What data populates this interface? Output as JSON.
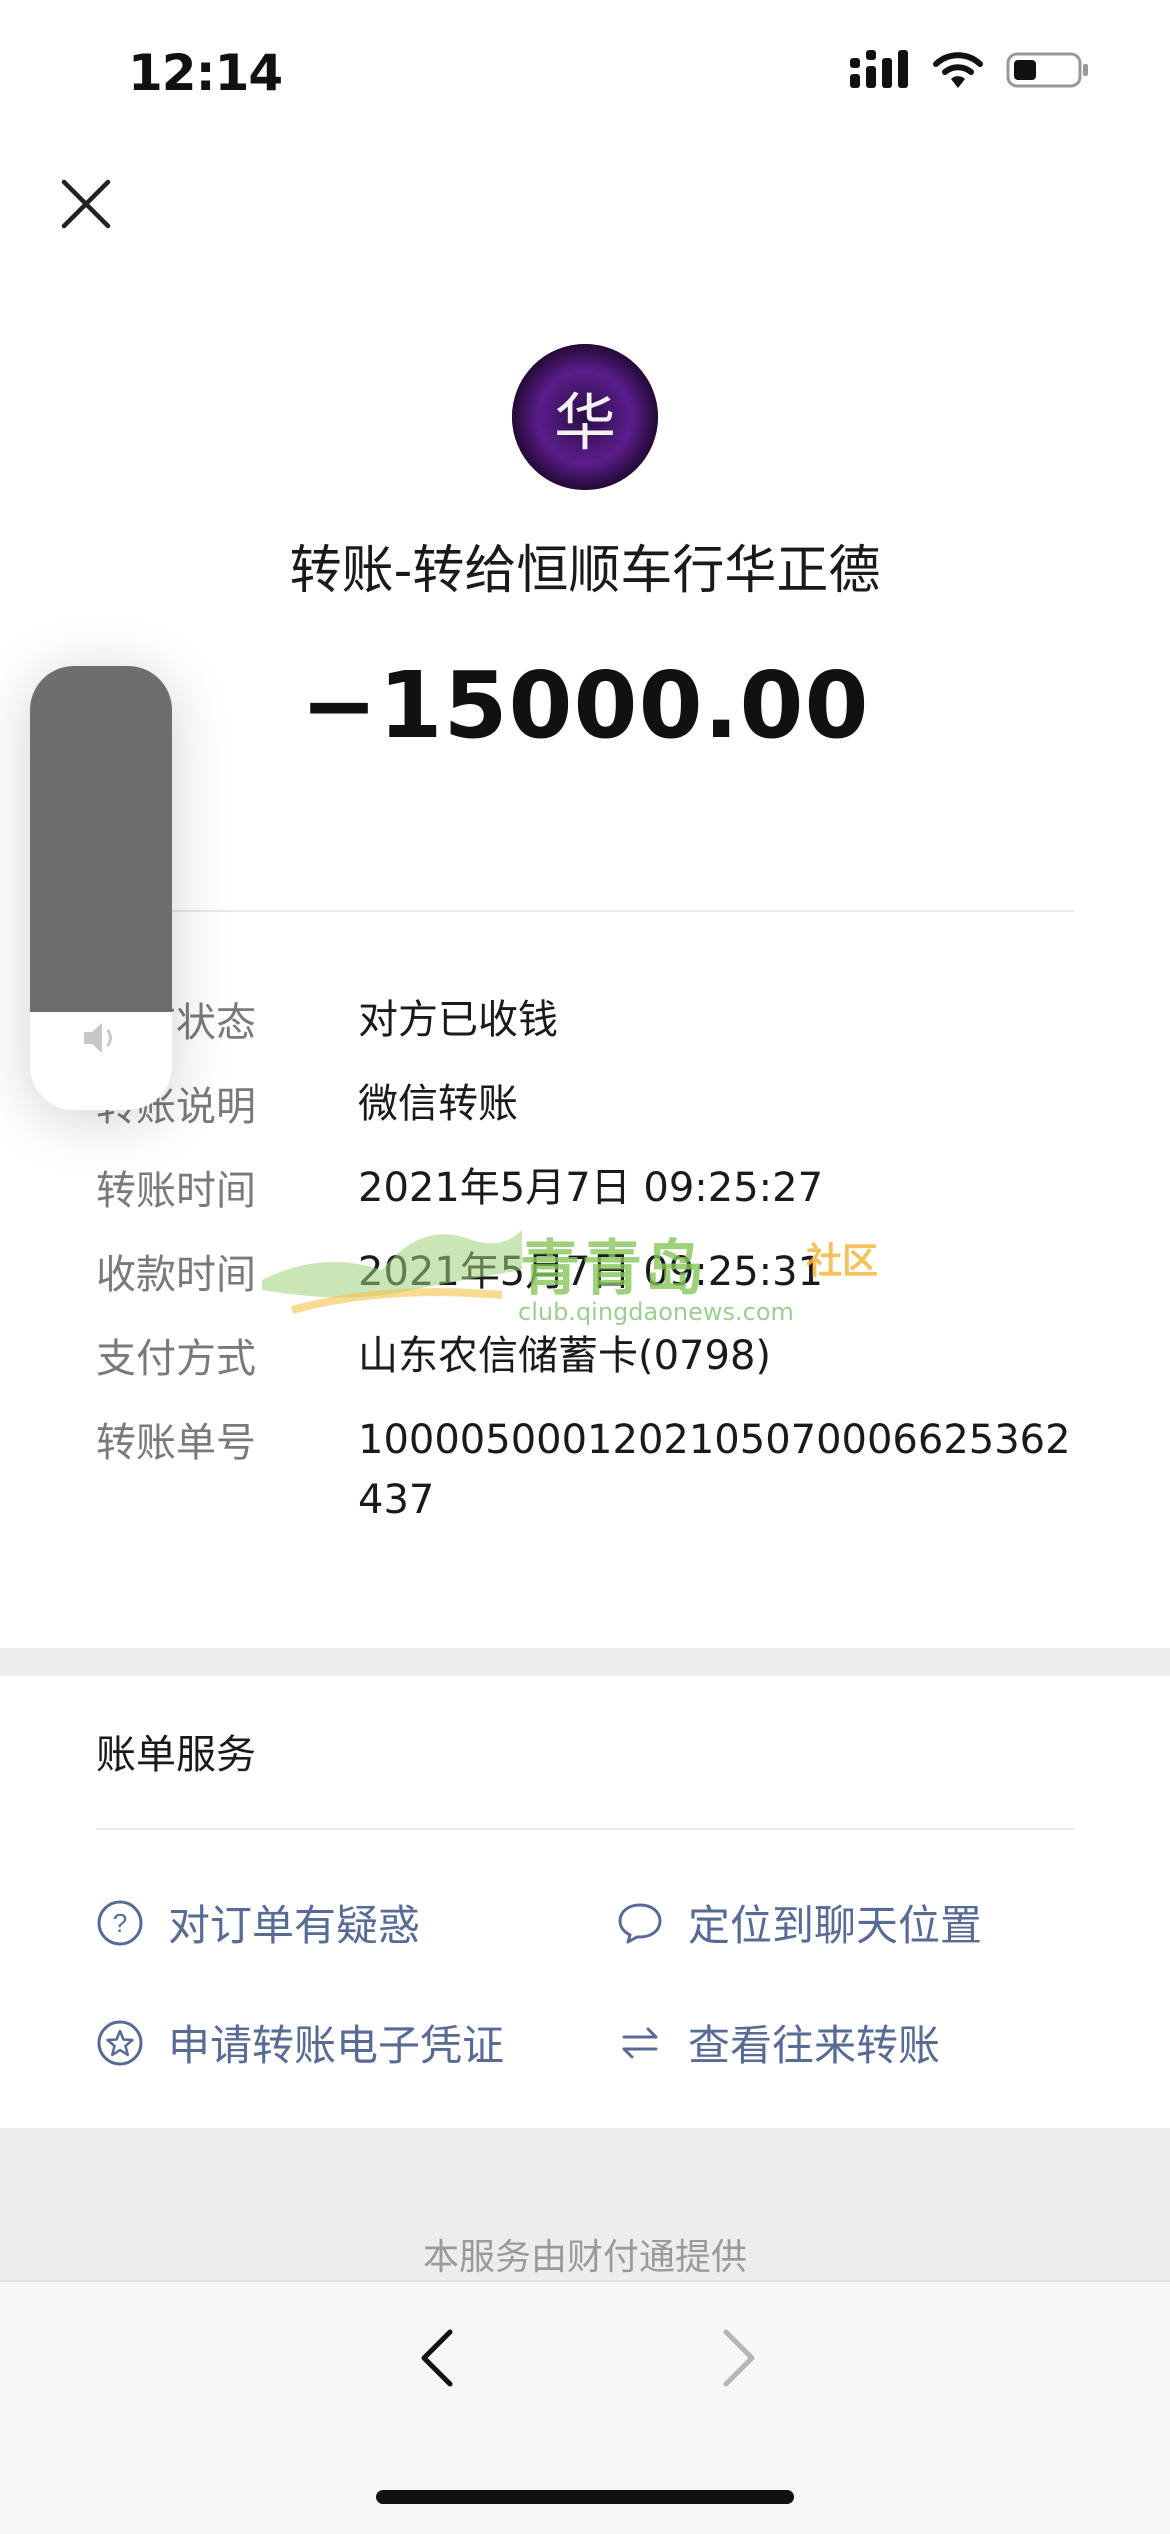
{
  "status_bar": {
    "time": "12:14"
  },
  "header": {
    "close_icon": "close-icon"
  },
  "payee": {
    "avatar_char": "华"
  },
  "title": "转账-转给恒顺车行华正德",
  "amount": "−15000.00",
  "details": [
    {
      "label": "当前状态",
      "value": "对方已收钱"
    },
    {
      "label": "转账说明",
      "value": "微信转账"
    },
    {
      "label": "转账时间",
      "value": "2021年5月7日 09:25:27"
    },
    {
      "label": "收款时间",
      "value": "2021年5月7日 09:25:31"
    },
    {
      "label": "支付方式",
      "value": "山东农信储蓄卡(0798)"
    },
    {
      "label": "转账单号",
      "value": "1000050001202105070006625362437"
    }
  ],
  "bill_services": {
    "title": "账单服务",
    "items": [
      {
        "label": "对订单有疑惑",
        "icon": "question-circle-icon"
      },
      {
        "label": "定位到聊天位置",
        "icon": "chat-bubble-icon"
      },
      {
        "label": "申请转账电子凭证",
        "icon": "star-circle-icon"
      },
      {
        "label": "查看往来转账",
        "icon": "swap-arrows-icon"
      }
    ]
  },
  "footer_note": "本服务由财付通提供",
  "watermark": {
    "brand": "青青岛",
    "suffix": "社区",
    "url": "club.qingdaonews.com"
  },
  "volume_level": 0.78,
  "colors": {
    "link": "#576b95",
    "label": "#7a7a7a",
    "band": "#ededed"
  }
}
